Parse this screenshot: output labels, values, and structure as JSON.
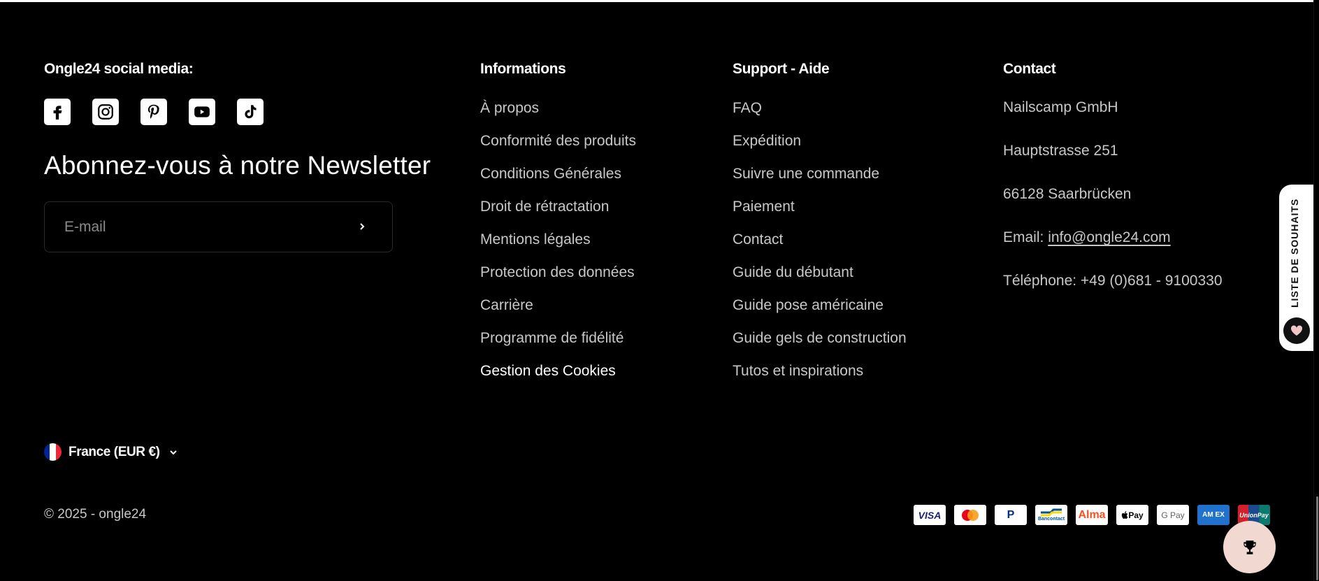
{
  "social": {
    "heading": "Ongle24 social media:",
    "icons": [
      "facebook-icon",
      "instagram-icon",
      "pinterest-icon",
      "youtube-icon",
      "tiktok-icon"
    ]
  },
  "newsletter": {
    "title": "Abonnez-vous à notre Newsletter",
    "email_placeholder": "E-mail",
    "email_value": ""
  },
  "informations": {
    "heading": "Informations",
    "links": [
      "À propos",
      "Conformité des produits",
      "Conditions Générales",
      "Droit de rétractation",
      "Mentions légales",
      "Protection des données",
      "Carrière",
      "Programme de fidélité",
      "Gestion des Cookies"
    ]
  },
  "support": {
    "heading": "Support - Aide",
    "links": [
      "FAQ",
      "Expédition",
      "Suivre une commande",
      "Paiement",
      "Contact",
      "Guide du débutant",
      "Guide pose américaine",
      "Guide gels de construction",
      "Tutos et inspirations"
    ]
  },
  "contact": {
    "heading": "Contact",
    "company": "Nailscamp GmbH",
    "street": "Hauptstrasse 251",
    "city": "66128 Saarbrücken",
    "email_label": "Email:",
    "email": "info@ongle24.com",
    "phone": "Téléphone: +49 (0)681 - 9100330"
  },
  "locale": {
    "label": "France (EUR €)",
    "flag_colors": [
      "#002395",
      "#ffffff",
      "#ed2939"
    ]
  },
  "copyright": "© 2025 - ongle24",
  "payments": [
    {
      "name": "visa",
      "label": "VISA"
    },
    {
      "name": "mastercard",
      "label": ""
    },
    {
      "name": "paypal",
      "label": "P"
    },
    {
      "name": "bancontact",
      "label": "Bancontact"
    },
    {
      "name": "alma",
      "label": "Alma"
    },
    {
      "name": "applepay",
      "label": "Pay"
    },
    {
      "name": "gpay",
      "label": "G Pay"
    },
    {
      "name": "amex",
      "label": "AM EX"
    },
    {
      "name": "unionpay",
      "label": "UnionPay"
    }
  ],
  "wishlist": {
    "label": "LISTE DE SOUHAITS"
  },
  "colors": {
    "background": "#000000",
    "text": "#ffffff",
    "muted_text": "#c8c8c8",
    "trophy_button": "#f1d9d2"
  }
}
